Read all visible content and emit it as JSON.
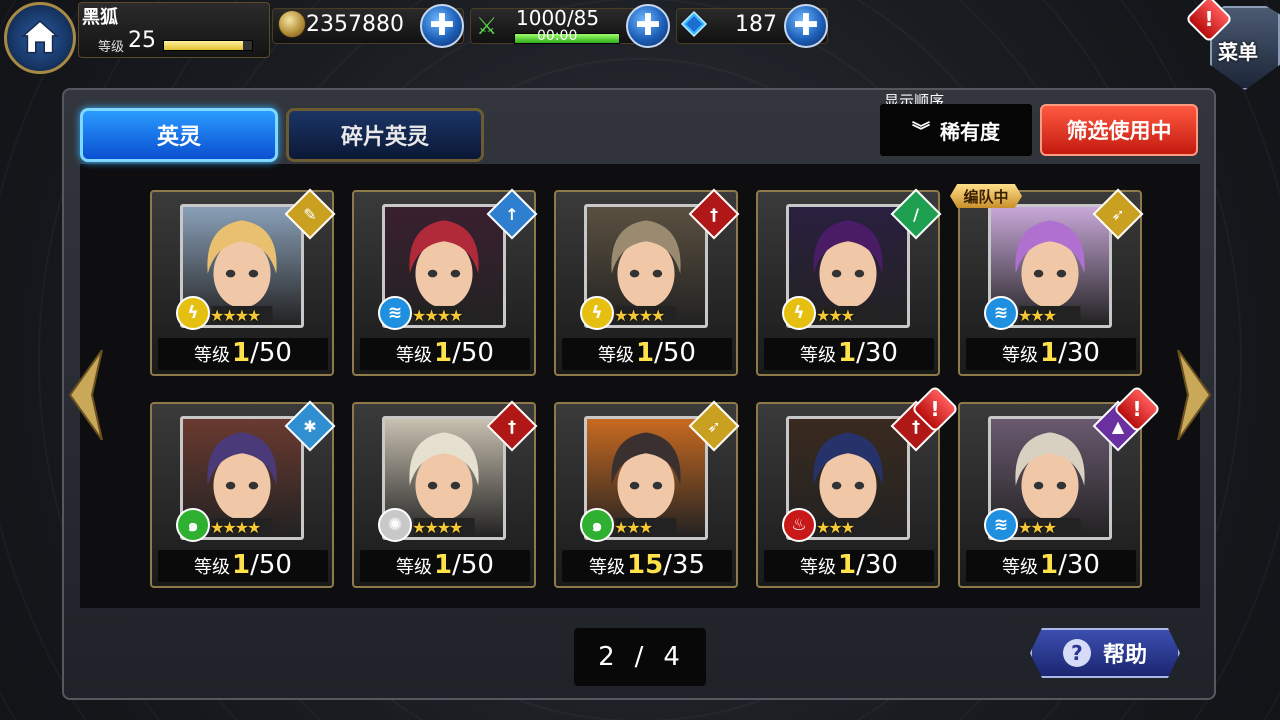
{
  "player": {
    "name": "黑狐",
    "level_label": "等级",
    "level": "25",
    "exp_fraction": 0.9
  },
  "resources": {
    "coins": "2357880",
    "stamina": "1000/85",
    "stamina_timer": "00:00",
    "gems": "187"
  },
  "menu": {
    "label": "菜单"
  },
  "tabs": [
    {
      "label": "英灵"
    },
    {
      "label": "碎片英灵"
    }
  ],
  "sort": {
    "caption": "显示顺序",
    "value": "稀有度"
  },
  "filter_button": "筛选使用中",
  "team_tag": "编队中",
  "level_prefix": "等级",
  "cards": [
    {
      "cur": "1",
      "max": "/50",
      "stars": "★★★★",
      "attr_icon": "wrench",
      "elem": "lightning",
      "hair": "#e8c070",
      "bg": "#8aa0b8"
    },
    {
      "cur": "1",
      "max": "/50",
      "stars": "★★★★",
      "attr_icon": "spear",
      "elem": "water",
      "hair": "#b02a3a",
      "bg": "#3a2030"
    },
    {
      "cur": "1",
      "max": "/50",
      "stars": "★★★★",
      "attr_icon": "sword",
      "elem": "lightning",
      "hair": "#9a8a70",
      "bg": "#5a5040"
    },
    {
      "cur": "1",
      "max": "/30",
      "stars": "★★★",
      "attr_icon": "blade",
      "elem": "lightning",
      "hair": "#4a1c66",
      "bg": "#2a2040"
    },
    {
      "cur": "1",
      "max": "/30",
      "stars": "★★★",
      "attr_icon": "bow",
      "elem": "water",
      "hair": "#b070d0",
      "bg": "#c8a8d8"
    },
    {
      "cur": "1",
      "max": "/50",
      "stars": "★★★★",
      "attr_icon": "shuriken",
      "elem": "wind",
      "hair": "#4a3a7a",
      "bg": "#6a3a30"
    },
    {
      "cur": "1",
      "max": "/50",
      "stars": "★★★★",
      "attr_icon": "sword",
      "elem": "light",
      "hair": "#e6e0d0",
      "bg": "#c8c0b0"
    },
    {
      "cur": "15",
      "max": "/35",
      "stars": "★★★",
      "attr_icon": "bow",
      "elem": "wind",
      "hair": "#3a3030",
      "bg": "#c86a20"
    },
    {
      "cur": "1",
      "max": "/30",
      "stars": "★★★",
      "attr_icon": "sword",
      "elem": "fire",
      "hair": "#26336a",
      "bg": "#3a2a20"
    },
    {
      "cur": "1",
      "max": "/30",
      "stars": "★★★",
      "attr_icon": "hat",
      "elem": "water",
      "hair": "#d8d0c0",
      "bg": "#6a5a70"
    }
  ],
  "pager": {
    "current": "2",
    "sep": "/",
    "total": "4"
  },
  "help_button": "帮助",
  "colors": {
    "accent_blue": "#1d7fff",
    "filter_red": "#d9281a",
    "level_gold": "#ffe24a",
    "frame_gold": "#8d7a48"
  }
}
